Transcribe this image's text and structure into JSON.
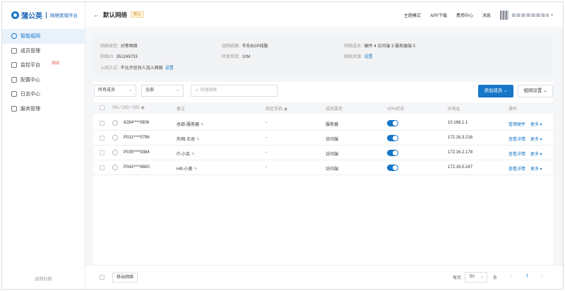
{
  "brand": {
    "name": "蒲公英",
    "subtitle": "网络管理平台"
  },
  "sidebar": {
    "items": [
      {
        "label": "智能组网",
        "active": true
      },
      {
        "label": "成员管理"
      },
      {
        "label": "监控平台",
        "badge": "测试"
      },
      {
        "label": "配置中心"
      },
      {
        "label": "日志中心"
      },
      {
        "label": "服务管理"
      }
    ],
    "footer": "返回旧版"
  },
  "header": {
    "back_icon": "←",
    "title": "默认网络",
    "badge": "默认",
    "links": [
      "主题模式",
      "APP下载",
      "费用中心",
      "消息"
    ]
  },
  "info": {
    "type_label": "网络类型:",
    "type_value": "对等网络",
    "line_label": "组网线路:",
    "line_value": "华东BGP线路",
    "members_label": "网络成员:",
    "members_value": "硬件 4   访问端 3   服务器端 0",
    "id_label": "网络ID:",
    "id_value": "351249733",
    "bandwidth_label": "转发带宽:",
    "bandwidth_value": "10M",
    "resource_label": "网络资源:",
    "resource_link": "设置",
    "join_label": "入网方式:",
    "join_value": "不允许任何人加入网络",
    "join_link": "设置"
  },
  "filters": {
    "member_select": "所有成员",
    "status_select": "全部",
    "search_placeholder": "快速搜索",
    "add_button": "添加成员",
    "settings_button": "组网设置"
  },
  "table": {
    "columns": [
      "SN / UID / SID",
      "备注",
      "绑定手机",
      "成员属性",
      "VPN状态",
      "IP地址",
      "操作"
    ],
    "rows": [
      {
        "id": "6284****0906",
        "note": "总部-服务器",
        "phone": "-",
        "attr": "服务器",
        "ip": "10.168.1.1",
        "action": "管理硬件",
        "more": "更多"
      },
      {
        "id": "P031****5796",
        "note": "外网-王总",
        "phone": "-",
        "attr": "访问端",
        "ip": "172.16.3.216",
        "action": "查看详情",
        "more": "更多"
      },
      {
        "id": "P035****9384",
        "note": "IT-小余",
        "phone": "-",
        "attr": "访问端",
        "ip": "172.16.2.178",
        "action": "查看详情",
        "more": "更多"
      },
      {
        "id": "P043****8600",
        "note": "HR-小美",
        "phone": "-",
        "attr": "访问端",
        "ip": "172.16.0.247",
        "action": "查看详情",
        "more": "更多"
      }
    ]
  },
  "footer": {
    "remove_button": "移出网络",
    "page_size_label": "每页",
    "page_size": "50",
    "page_unit": "条",
    "prev": "‹",
    "current_page": "1",
    "next": "›"
  },
  "colors": {
    "primary": "#1677c8",
    "badge_text": "#c88a1e",
    "sidebar_active_bg": "#e9f1fb"
  }
}
